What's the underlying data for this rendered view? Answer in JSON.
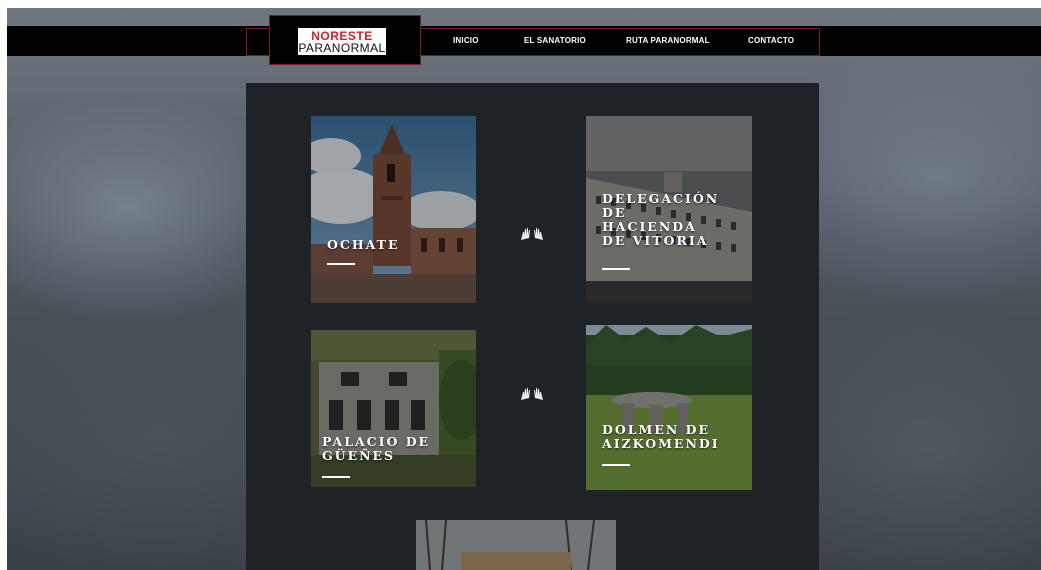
{
  "brand": {
    "line1": "NORESTE",
    "line2": "PARANORMAL"
  },
  "nav": [
    "INICIO",
    "EL SANATORIO",
    "RUTA PARANORMAL",
    "CONTACTO"
  ],
  "cards": [
    {
      "title": "OCHATE"
    },
    {
      "title": "DELEGACIÓN DE HACIENDA DE VITORIA"
    },
    {
      "title": "PALACIO DE GÜEÑES"
    },
    {
      "title": "DOLMEN DE AIZKOMENDI"
    }
  ],
  "colors": {
    "accent": "#d21f2b",
    "nav_border": "#7a1a22",
    "panel": "#1e2328"
  }
}
